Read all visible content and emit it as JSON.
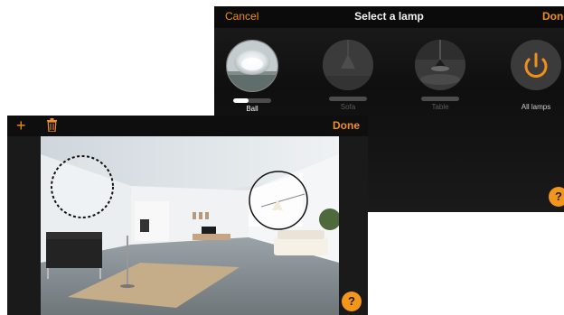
{
  "select_panel": {
    "cancel_label": "Cancel",
    "title": "Select a lamp",
    "done_label": "Done",
    "lamps": [
      {
        "label": "Ball",
        "level": 0.4,
        "active": true
      },
      {
        "label": "Sofa",
        "level": 0,
        "active": false
      },
      {
        "label": "Table",
        "level": 0,
        "active": false
      },
      {
        "label": "All lamps",
        "icon": "power-icon",
        "active": true
      }
    ],
    "help_label": "?"
  },
  "room_panel": {
    "add_label": "+",
    "delete_icon": "trash-icon",
    "done_label": "Done",
    "help_label": "?"
  },
  "colors": {
    "accent": "#f0901a",
    "panel_bg": "#1a1a1a"
  }
}
